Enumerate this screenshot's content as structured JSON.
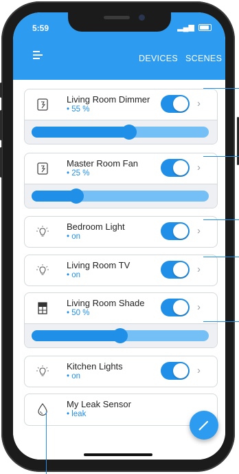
{
  "status_bar": {
    "time": "5:59",
    "signal": "▂▄▆"
  },
  "header": {
    "menu_icon": "hamburger-icon",
    "tabs": [
      "DEVICES",
      "SCENES"
    ]
  },
  "devices": [
    {
      "name": "Living Room Dimmer",
      "status": "• 55 %",
      "icon": "dimmer-switch-icon",
      "toggle_on": true,
      "level": 0.55
    },
    {
      "name": "Master Room Fan",
      "status": "• 25 %",
      "icon": "fan-switch-icon",
      "toggle_on": true,
      "level": 0.25
    },
    {
      "name": "Bedroom Light",
      "status": "• on",
      "icon": "light-bulb-icon",
      "toggle_on": true
    },
    {
      "name": "Living Room TV",
      "status": "• on",
      "icon": "light-bulb-icon",
      "toggle_on": true
    },
    {
      "name": "Living Room Shade",
      "status": "• 50 %",
      "icon": "window-shade-icon",
      "toggle_on": true,
      "level": 0.5
    },
    {
      "name": "Kitchen Lights",
      "status": "• on",
      "icon": "light-bulb-icon",
      "toggle_on": true
    },
    {
      "name": "My Leak Sensor",
      "status": "• leak",
      "icon": "water-drop-icon"
    }
  ],
  "fab": {
    "icon": "pencil-icon"
  },
  "colors": {
    "accent": "#2d9bf0",
    "track": "#74bff5",
    "status_text": "#1f8fe8"
  }
}
